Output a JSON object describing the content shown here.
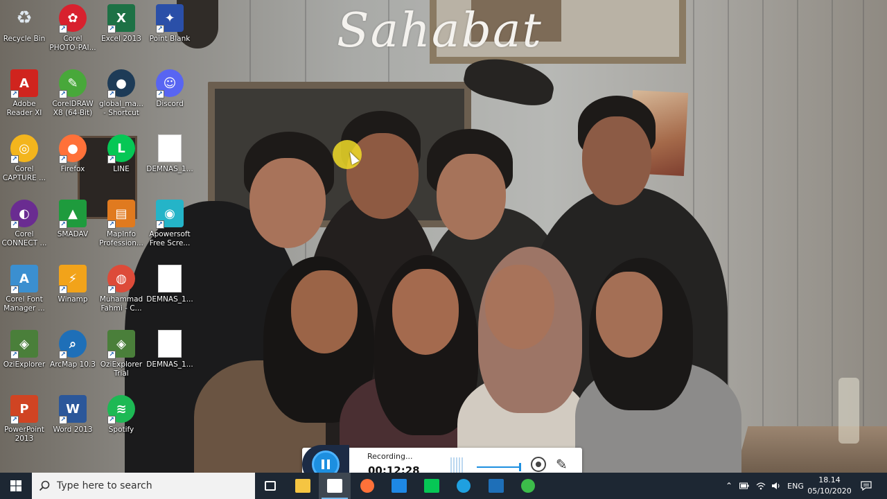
{
  "wallpaper": {
    "overlay_text": "Sahabat"
  },
  "desktop_icons": [
    {
      "label": "Recycle Bin",
      "icon": "recycle-bin-icon",
      "color": "#c8d2dc"
    },
    {
      "label": "Corel PHOTO-PAI...",
      "icon": "corel-photo-paint-icon",
      "color": "#d8212e"
    },
    {
      "label": "Excel 2013",
      "icon": "excel-icon",
      "color": "#1d7145"
    },
    {
      "label": "Point Blank",
      "icon": "point-blank-icon",
      "color": "#2a4fa8"
    },
    {
      "label": "Adobe Reader XI",
      "icon": "adobe-reader-icon",
      "color": "#d0241e"
    },
    {
      "label": "CorelDRAW X8 (64-Bit)",
      "icon": "coreldraw-icon",
      "color": "#48a83a"
    },
    {
      "label": "global_ma... - Shortcut",
      "icon": "globe-icon",
      "color": "#1d3b57"
    },
    {
      "label": "Discord",
      "icon": "discord-icon",
      "color": "#5865f2"
    },
    {
      "label": "Corel CAPTURE ...",
      "icon": "corel-capture-icon",
      "color": "#f3b51d"
    },
    {
      "label": "Firefox",
      "icon": "firefox-icon",
      "color": "#ff7139"
    },
    {
      "label": "LINE",
      "icon": "line-icon",
      "color": "#06c755"
    },
    {
      "label": "DEMNAS_1...",
      "icon": "blank-file-icon",
      "color": "#ffffff"
    },
    {
      "label": "Corel CONNECT ...",
      "icon": "corel-connect-icon",
      "color": "#6a2c91"
    },
    {
      "label": "SMADAV",
      "icon": "smadav-icon",
      "color": "#1e9b3d"
    },
    {
      "label": "MapInfo Profession...",
      "icon": "mapinfo-icon",
      "color": "#e07a1f"
    },
    {
      "label": "Apowersoft Free Scre...",
      "icon": "apowersoft-recorder-icon",
      "color": "#24b4c8"
    },
    {
      "label": "Corel Font Manager ...",
      "icon": "corel-font-manager-icon",
      "color": "#3b8fd0"
    },
    {
      "label": "Winamp",
      "icon": "winamp-icon",
      "color": "#f2a31a"
    },
    {
      "label": "Muhammad Fahmi - C...",
      "icon": "chrome-icon",
      "color": "#dd4b39"
    },
    {
      "label": "DEMNAS_1...",
      "icon": "blank-file-icon",
      "color": "#ffffff"
    },
    {
      "label": "OziExplorer",
      "icon": "oziexplorer-icon",
      "color": "#4a7f3a"
    },
    {
      "label": "ArcMap 10.3",
      "icon": "arcmap-icon",
      "color": "#1e6fb8"
    },
    {
      "label": "OziExplorer Trial",
      "icon": "oziexplorer-icon",
      "color": "#4a7f3a"
    },
    {
      "label": "DEMNAS_1...",
      "icon": "blank-file-icon",
      "color": "#ffffff"
    },
    {
      "label": "PowerPoint 2013",
      "icon": "powerpoint-icon",
      "color": "#d04423"
    },
    {
      "label": "Word 2013",
      "icon": "word-icon",
      "color": "#2b579a"
    },
    {
      "label": "Spotify",
      "icon": "spotify-icon",
      "color": "#1db954"
    }
  ],
  "recorder": {
    "status": "Recording...",
    "elapsed": "00:12:28"
  },
  "taskbar": {
    "search_placeholder": "Type here to search",
    "apps": [
      {
        "name": "task-view",
        "color": "#ffffff"
      },
      {
        "name": "file-explorer",
        "color": "#f5c542"
      },
      {
        "name": "microsoft-store",
        "color": "#ffffff",
        "active": true
      },
      {
        "name": "firefox",
        "color": "#ff7139"
      },
      {
        "name": "mail",
        "color": "#1e88e5"
      },
      {
        "name": "line",
        "color": "#06c755"
      },
      {
        "name": "edge",
        "color": "#1fa0e0"
      },
      {
        "name": "arcmap",
        "color": "#1e6fb8"
      },
      {
        "name": "apowersoft-recorder",
        "color": "#3cbc4a"
      }
    ],
    "language": "ENG",
    "time": "18.14",
    "date": "05/10/2020"
  }
}
